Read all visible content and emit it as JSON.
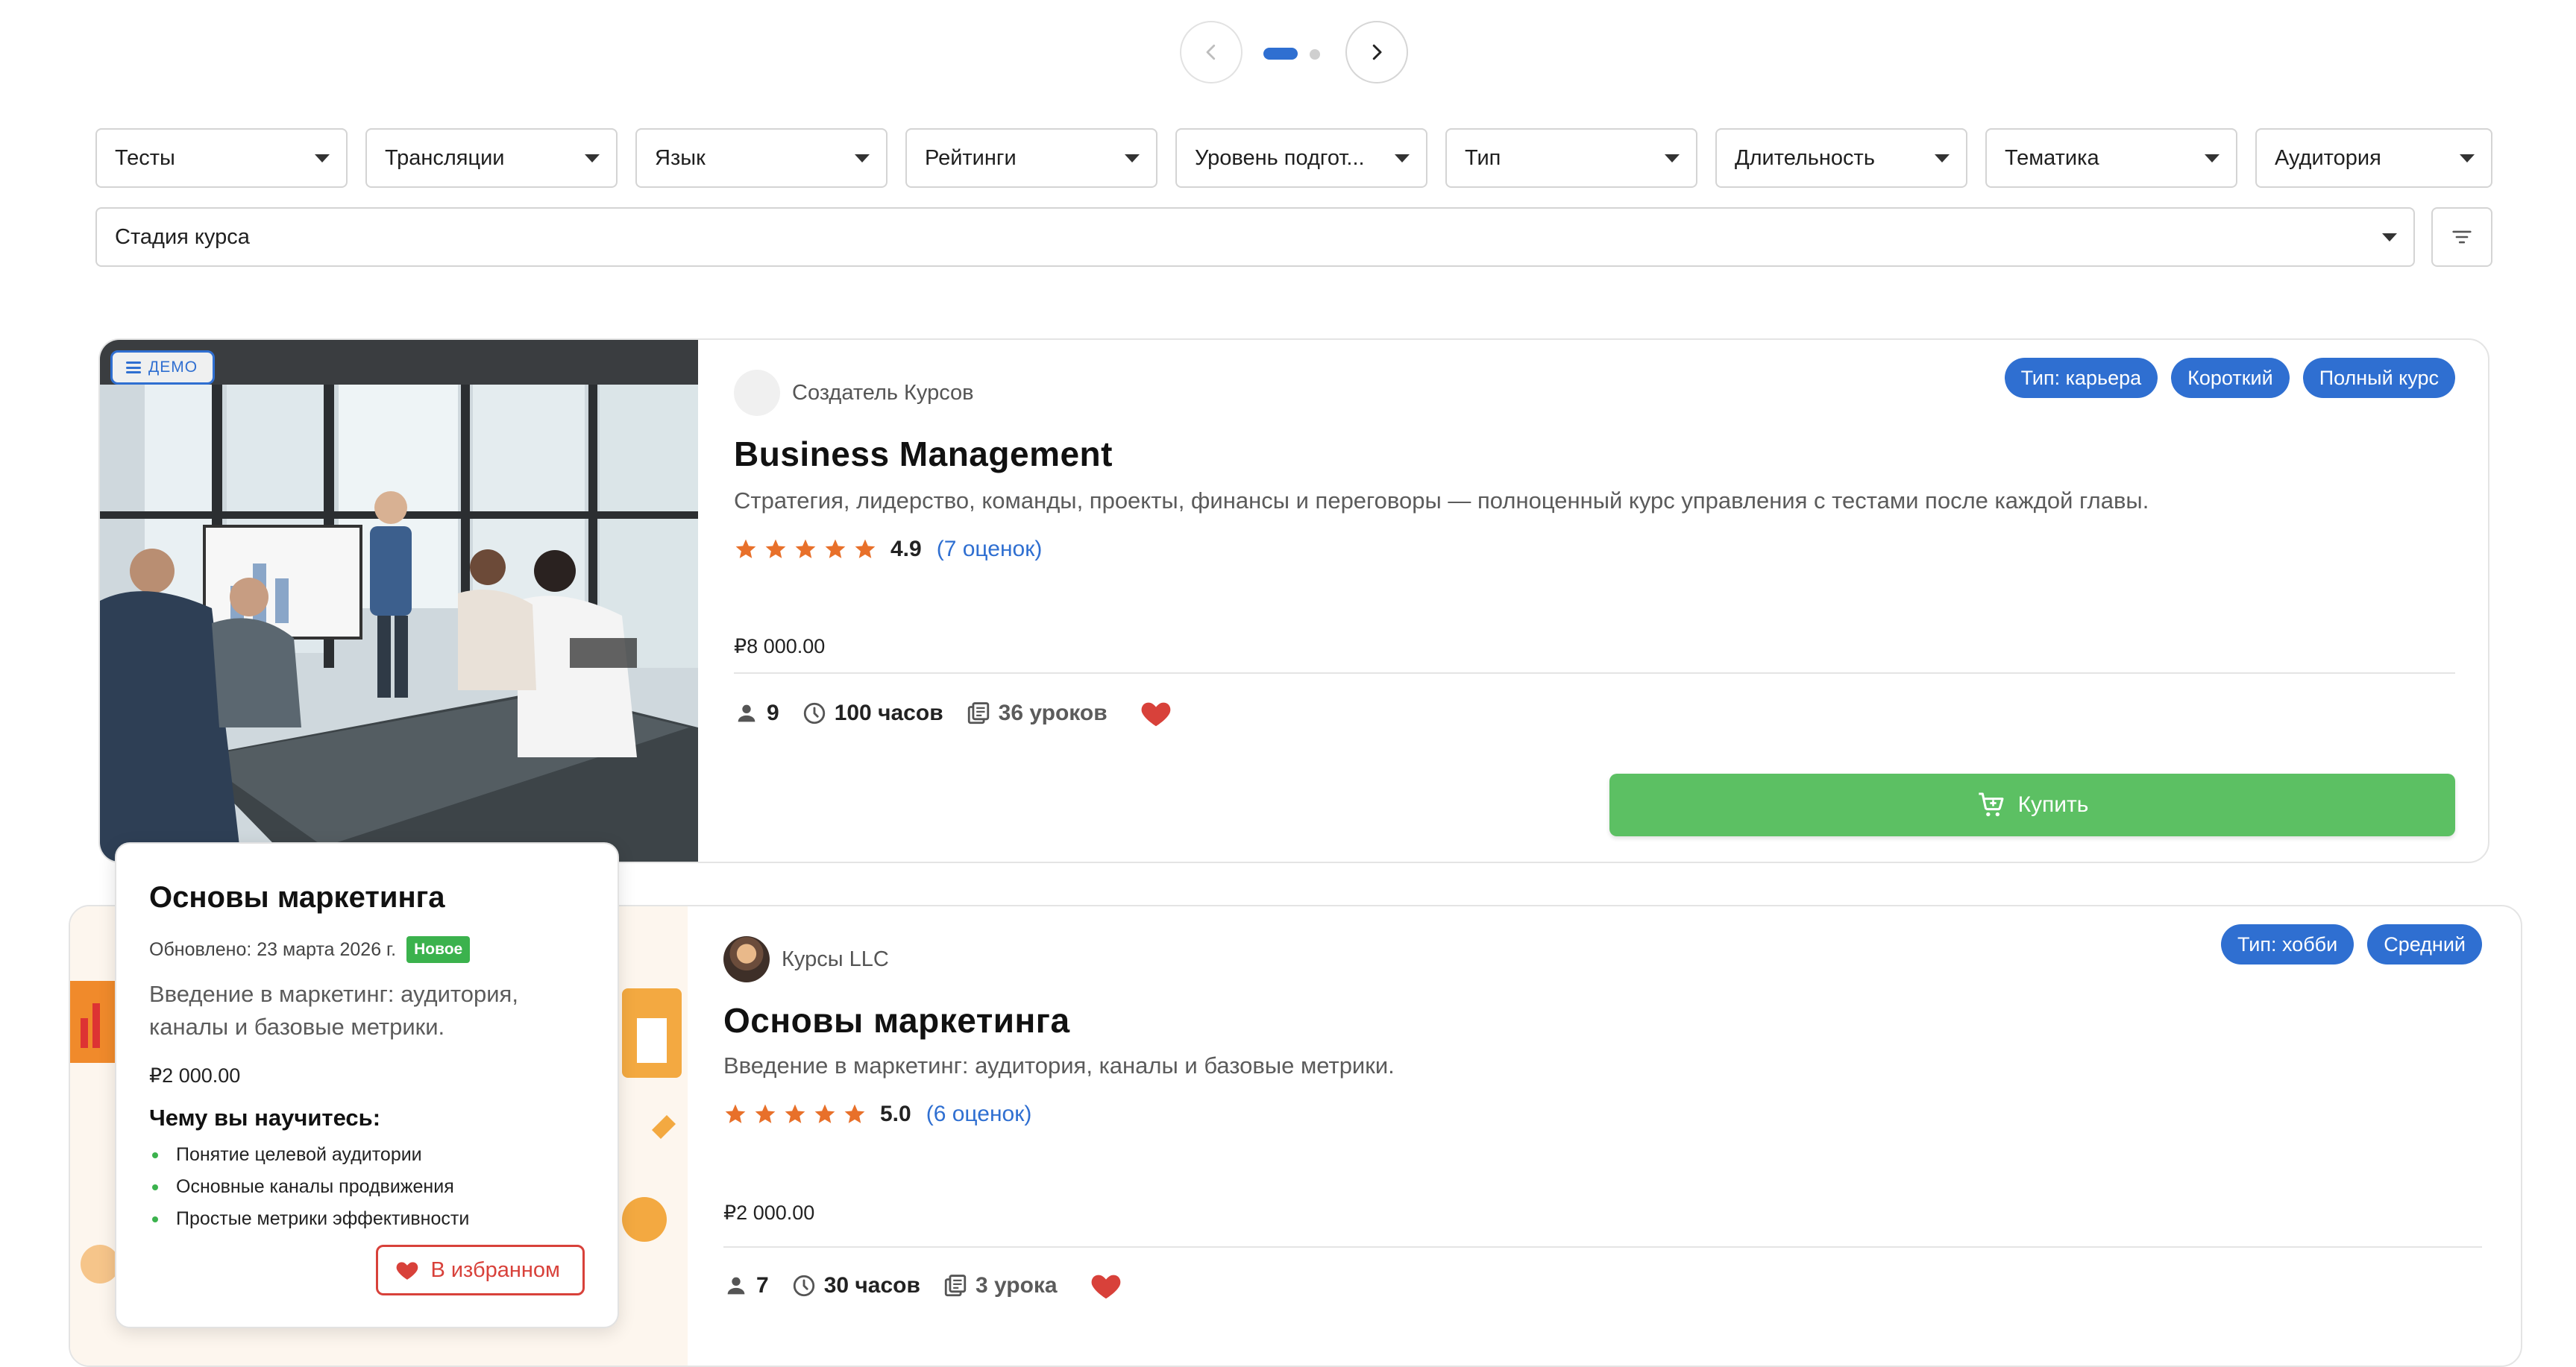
{
  "pager": {
    "prev_label": "‹",
    "next_label": "›",
    "pages": 2,
    "active_page": 1
  },
  "filters": [
    {
      "label": "Тесты"
    },
    {
      "label": "Трансляции"
    },
    {
      "label": "Язык"
    },
    {
      "label": "Рейтинги"
    },
    {
      "label": "Уровень подгот..."
    },
    {
      "label": "Тип"
    },
    {
      "label": "Длительность"
    },
    {
      "label": "Тематика"
    },
    {
      "label": "Аудитория"
    }
  ],
  "stage_filter": {
    "label": "Стадия курса"
  },
  "courses": [
    {
      "demo_label": "ДЕМО",
      "author": "Создатель Курсов",
      "tags": [
        "Тип: карьера",
        "Короткий",
        "Полный курс"
      ],
      "title": "Business Management",
      "description": "Стратегия, лидерство, команды, проекты, финансы и переговоры — полноценный курс управления с тестами после каждой главы.",
      "rating": "4.9",
      "rating_count": "(7 оценок)",
      "price": "₽8 000.00",
      "students": "9",
      "duration": "100 часов",
      "lessons": "36 уроков",
      "buy_label": "Купить",
      "favorite": true
    },
    {
      "author": "Курсы LLC",
      "tags": [
        "Тип: хобби",
        "Средний"
      ],
      "title": "Основы маркетинга",
      "description": "Введение в маркетинг: аудитория, каналы и базовые метрики.",
      "rating": "5.0",
      "rating_count": "(6 оценок)",
      "price": "₽2 000.00",
      "students": "7",
      "duration": "30 часов",
      "lessons": "3 урока",
      "favorite": true
    }
  ],
  "popup": {
    "title": "Основы маркетинга",
    "updated": "Обновлено: 23 марта 2026 г.",
    "new_badge": "Новое",
    "description": "Введение в маркетинг: аудитория, каналы и базовые метрики.",
    "price": "₽2 000.00",
    "learn_heading": "Чему вы научитесь:",
    "learn_items": [
      "Понятие целевой аудитории",
      "Основные каналы продвижения",
      "Простые метрики эффективности"
    ],
    "favorite_button": "В избранном"
  },
  "colors": {
    "accent": "#2f6fd1",
    "buy": "#5cc063",
    "star": "#e8702a",
    "heart": "#d8413a",
    "new": "#3bb24d"
  }
}
